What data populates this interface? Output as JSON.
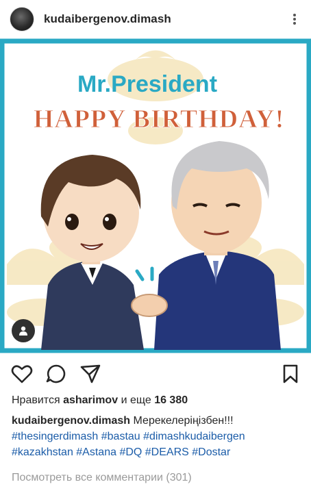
{
  "post": {
    "username": "kudaibergenov.dimash",
    "image": {
      "title": "Mr.President",
      "subtitle": "HAPPY BIRTHDAY!",
      "frame_color": "#2aa9c4",
      "title_color": "#2aa9c4",
      "subtitle_color": "#d0603a"
    },
    "likes": {
      "prefix": "Нравится",
      "user": "asharimov",
      "middle": "и еще",
      "count": "16 380"
    },
    "caption": {
      "author": "kudaibergenov.dimash",
      "text": "Мерекелеріңізбен!!!",
      "hashtags": "#thesingerdimash #bastau #dimashkudaibergen #kazakhstan #Astana #DQ #DEARS #Dostar"
    },
    "view_comments": "Посмотреть все комментарии (301)"
  },
  "icons": {
    "avatar": "avatar",
    "more": "more-vertical-icon",
    "user_tag": "user-tag-icon",
    "like": "heart-icon",
    "comment": "comment-icon",
    "share": "share-icon",
    "save": "bookmark-icon"
  }
}
